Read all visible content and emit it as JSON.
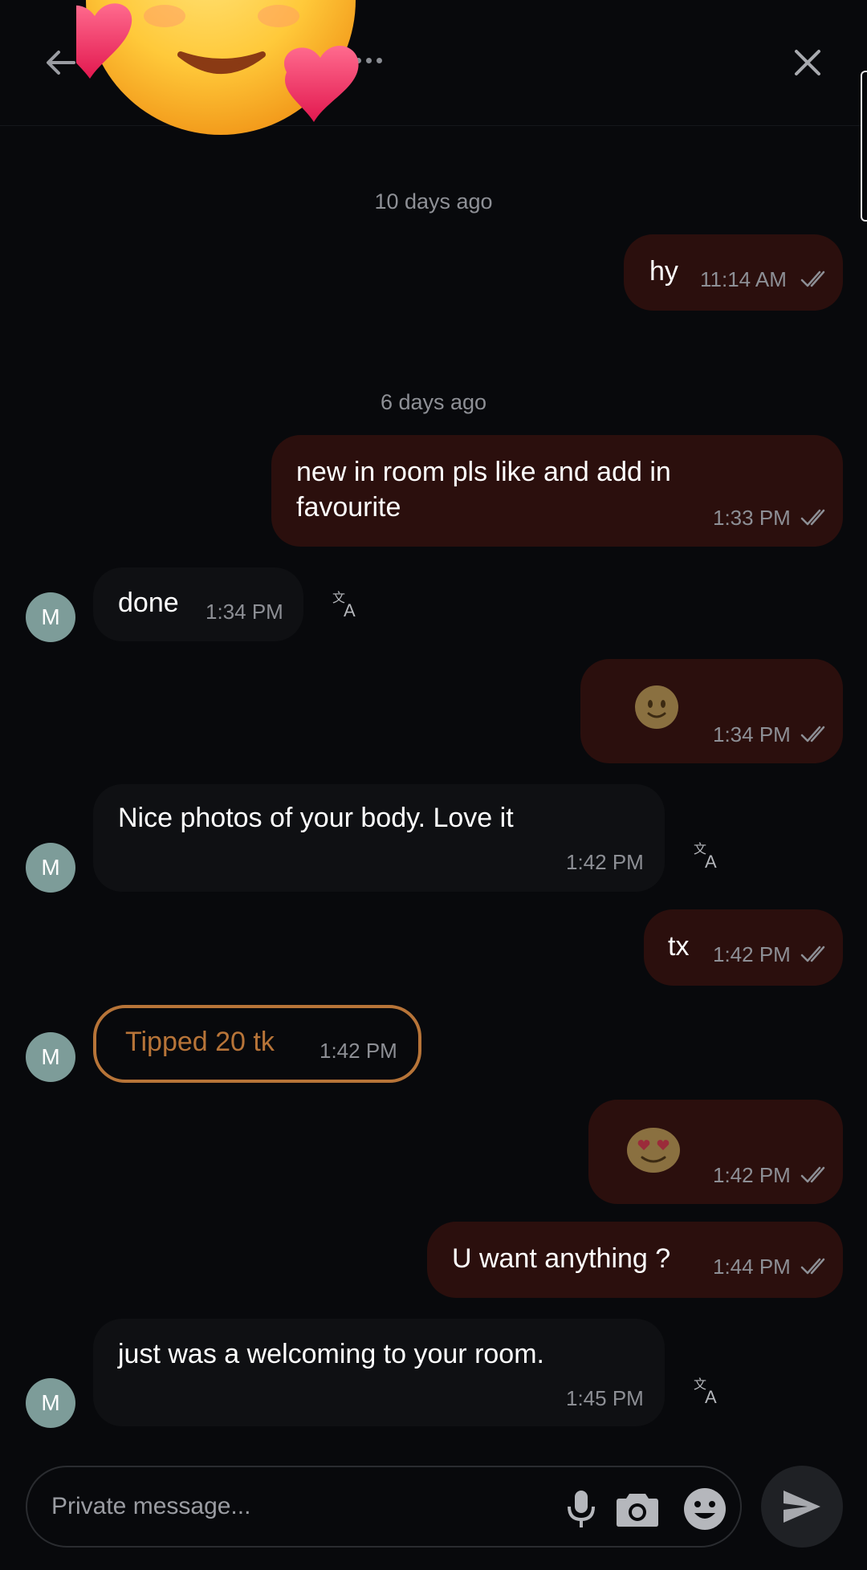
{
  "header": {
    "back_icon": "arrow-left-icon",
    "more_icon": "more-horizontal-icon",
    "close_icon": "close-icon",
    "sticker": "smiling-face-with-hearts"
  },
  "messages": {
    "date_1": "10 days ago",
    "m1": {
      "text": "hy",
      "time": "11:14 AM"
    },
    "date_2": "6 days ago",
    "m2": {
      "line1": "new in room pls like and add in",
      "line2": "favourite",
      "time": "1:33 PM"
    },
    "m3": {
      "avatar": "M",
      "text": "done",
      "time": "1:34 PM"
    },
    "m4": {
      "emoji": "slightly-smiling-face",
      "time": "1:34 PM"
    },
    "m5": {
      "avatar": "M",
      "text": "Nice photos of your body. Love it",
      "time": "1:42 PM"
    },
    "m6": {
      "text": "tx",
      "time": "1:42 PM"
    },
    "m7": {
      "avatar": "M",
      "text": "Tipped 20 tk",
      "time": "1:42 PM"
    },
    "m8": {
      "emoji": "smiling-face-with-heart-eyes",
      "time": "1:42 PM"
    },
    "m9": {
      "text": "U want anything ?",
      "time": "1:44 PM"
    },
    "m10": {
      "avatar": "M",
      "text": "just was a welcoming to your room.",
      "time": "1:45 PM"
    }
  },
  "composer": {
    "placeholder": "Private message...",
    "mic_icon": "microphone-icon",
    "camera_icon": "camera-icon",
    "emoji_icon": "emoji-icon",
    "send_icon": "send-icon"
  },
  "colors": {
    "background": "#08090c",
    "outgoing_bubble": "#2b0f0d",
    "incoming_bubble": "#0f1013",
    "tip_accent": "#b77438",
    "avatar": "#7d9c99"
  }
}
